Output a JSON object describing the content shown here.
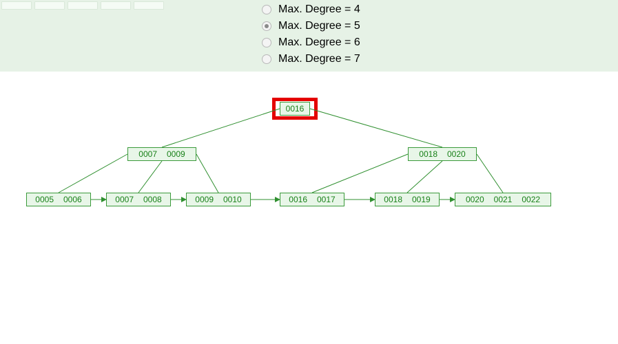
{
  "controls": {
    "options": [
      {
        "label": "Max. Degree = 4",
        "checked": false
      },
      {
        "label": "Max. Degree = 5",
        "checked": true
      },
      {
        "label": "Max. Degree = 6",
        "checked": false
      },
      {
        "label": "Max. Degree = 7",
        "checked": false
      }
    ]
  },
  "tree": {
    "root": {
      "keys": [
        "0016"
      ]
    },
    "internal": [
      {
        "keys": [
          "0007",
          "0009"
        ]
      },
      {
        "keys": [
          "0018",
          "0020"
        ]
      }
    ],
    "leaves": [
      {
        "keys": [
          "0005",
          "0006"
        ]
      },
      {
        "keys": [
          "0007",
          "0008"
        ]
      },
      {
        "keys": [
          "0009",
          "0010"
        ]
      },
      {
        "keys": [
          "0016",
          "0017"
        ]
      },
      {
        "keys": [
          "0018",
          "0019"
        ]
      },
      {
        "keys": [
          "0020",
          "0021",
          "0022"
        ]
      }
    ]
  }
}
